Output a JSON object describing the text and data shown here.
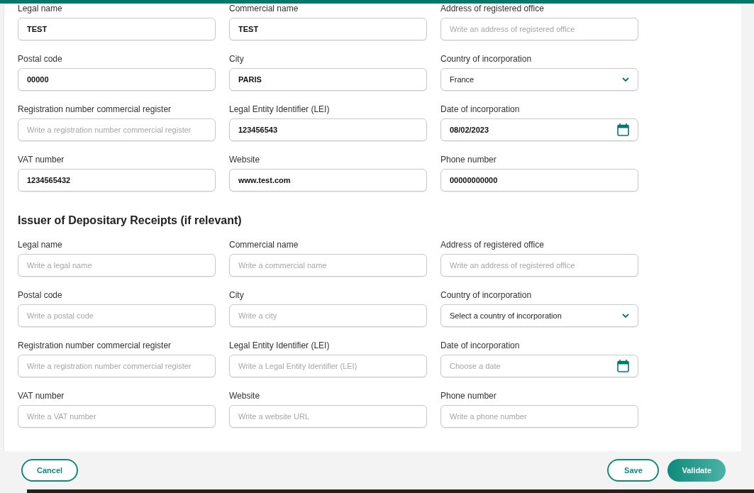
{
  "sections": [
    {
      "fields": [
        {
          "label": "Legal name",
          "kind": "text",
          "value": "TEST"
        },
        {
          "label": "Commercial name",
          "kind": "text",
          "value": "TEST"
        },
        {
          "label": "Address of registered office",
          "kind": "text",
          "placeholder": "Write an address of registered office"
        },
        {
          "label": "Postal code",
          "kind": "text",
          "value": "00000"
        },
        {
          "label": "City",
          "kind": "text",
          "value": "PARIS"
        },
        {
          "label": "Country of incorporation",
          "kind": "select",
          "value": "France"
        },
        {
          "label": "Registration number commercial register",
          "kind": "text",
          "placeholder": "Write a registration number commercial register"
        },
        {
          "label": "Legal Entity Identifier (LEI)",
          "kind": "text",
          "value": "123456543"
        },
        {
          "label": "Date of incorporation",
          "kind": "date",
          "value": "08/02/2023"
        },
        {
          "label": "VAT number",
          "kind": "text",
          "value": "1234565432"
        },
        {
          "label": "Website",
          "kind": "text",
          "value": "www.test.com"
        },
        {
          "label": "Phone number",
          "kind": "text",
          "value": "00000000000"
        }
      ]
    },
    {
      "title": "Issuer of Depositary Receipts (if relevant)",
      "fields": [
        {
          "label": "Legal name",
          "kind": "text",
          "placeholder": "Write a legal name"
        },
        {
          "label": "Commercial name",
          "kind": "text",
          "placeholder": "Write a commercial name"
        },
        {
          "label": "Address of registered office",
          "kind": "text",
          "placeholder": "Write an address of registered office"
        },
        {
          "label": "Postal code",
          "kind": "text",
          "placeholder": "Write a postal code"
        },
        {
          "label": "City",
          "kind": "text",
          "placeholder": "Write a city"
        },
        {
          "label": "Country of incorporation",
          "kind": "select",
          "value": "Select a country of incorporation"
        },
        {
          "label": "Registration number commercial register",
          "kind": "text",
          "placeholder": "Write a registration number commercial register"
        },
        {
          "label": "Legal Entity Identifier (LEI)",
          "kind": "text",
          "placeholder": "Write a Legal Entity Identifier (LEI)"
        },
        {
          "label": "Date of incorporation",
          "kind": "date",
          "placeholder": "Choose a date"
        },
        {
          "label": "VAT number",
          "kind": "text",
          "placeholder": "Write a VAT number"
        },
        {
          "label": "Website",
          "kind": "text",
          "placeholder": "Write a website URL"
        },
        {
          "label": "Phone number",
          "kind": "text",
          "placeholder": "Write a phone number"
        }
      ]
    }
  ],
  "footer": {
    "buttons": [
      {
        "label": "Cancel",
        "kind": "outline"
      },
      {
        "label": "Save",
        "kind": "outline"
      },
      {
        "label": "Validate",
        "kind": "primary"
      }
    ]
  }
}
